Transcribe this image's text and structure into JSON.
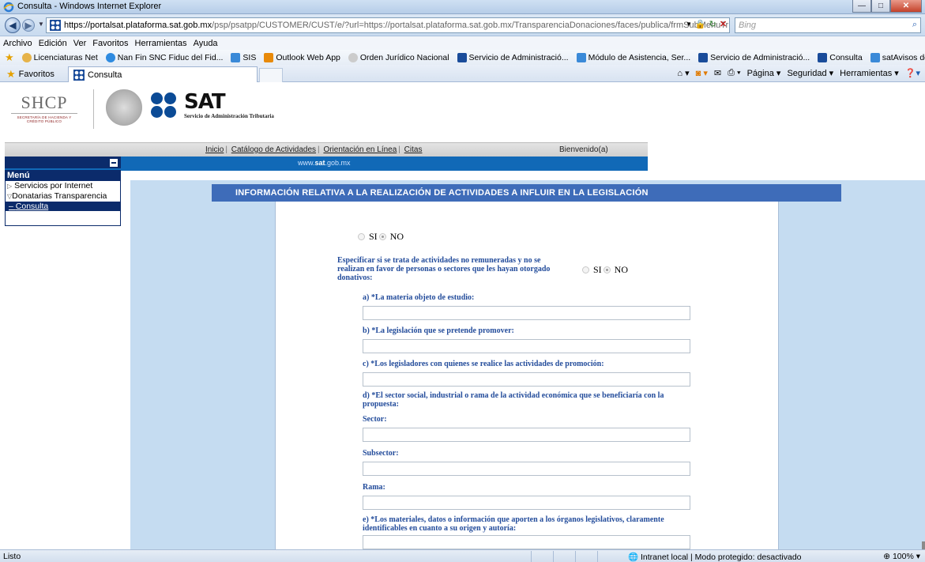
{
  "window": {
    "title": "Consulta - Windows Internet Explorer"
  },
  "address": {
    "url_host": "https://portalsat.plataforma.sat.gob.mx",
    "url_path": "/psp/psatpp/CUSTOMER/CUST/e/?url=https://portalsat.plataforma.sat.gob.mx/TransparenciaDonaciones/faces/publica/frmSubMenuTr",
    "search_placeholder": "Bing"
  },
  "menubar": [
    "Archivo",
    "Edición",
    "Ver",
    "Favoritos",
    "Herramientas",
    "Ayuda"
  ],
  "favorites_bar": [
    "Licenciaturas Net",
    "Nan Fin SNC Fiduc del Fid...",
    "SIS",
    "Outlook Web App",
    "Orden Jurídico Nacional",
    "Servicio de Administració...",
    "Módulo de Asistencia, Ser...",
    "Servicio de Administració...",
    "Consulta",
    "satAvisos de Donación y ..."
  ],
  "tabs": {
    "favorites_label": "Favoritos",
    "active_tab": "Consulta"
  },
  "command_bar": [
    "Página ▾",
    "Seguridad ▾",
    "Herramientas ▾"
  ],
  "header": {
    "shcp": "SHCP",
    "shcp_sub": "SECRETARÍA DE HACIENDA Y CRÉDITO PÚBLICO",
    "sat": "SAT",
    "sat_sub": "Servicio de Administración Tributaria",
    "nav_links": [
      "Inicio",
      "Catálogo de Actividades",
      "Orientación en Línea",
      "Citas"
    ],
    "welcome": "Bienvenido(a)",
    "site_pre": "www.",
    "site_bold": "sat",
    "site_post": ".gob.mx"
  },
  "menu": {
    "title": "Menú",
    "items": [
      "Servicios por Internet",
      "Donatarias Transparencia"
    ],
    "sub_item": "Consulta"
  },
  "form": {
    "section_title": "INFORMACIÓN RELATIVA A LA REALIZACIÓN DE ACTIVIDADES A INFLUIR EN LA LEGISLACIÓN",
    "radio_yes": "SI",
    "radio_no": "NO",
    "q_unpaid_line1": "Especificar si se trata de actividades no remuneradas y no se",
    "q_unpaid_line2": "realizan en favor de personas o sectores que les hayan otorgado",
    "q_unpaid_line3": "donativos:",
    "q_a": "a) *La materia objeto de estudio:",
    "q_b": "b) *La legislación que se pretende promover:",
    "q_c": "c) *Los legisladores con quienes se realice las actividades de promoción:",
    "q_d_line1": "d) *El sector social, industrial o rama de la actividad económica que se beneficiaría con la",
    "q_d_line2": "propuesta:",
    "sector": "Sector:",
    "subsector": "Subsector:",
    "rama": "Rama:",
    "q_e_line1": "e) *Los materiales, datos o información que aporten a los órganos legislativos, claramente",
    "q_e_line2": "identificables en cuanto a su origen y autoría:"
  },
  "status": {
    "left": "Listo",
    "zone": "Intranet local | Modo protegido: desactivado",
    "zoom": "100%"
  }
}
